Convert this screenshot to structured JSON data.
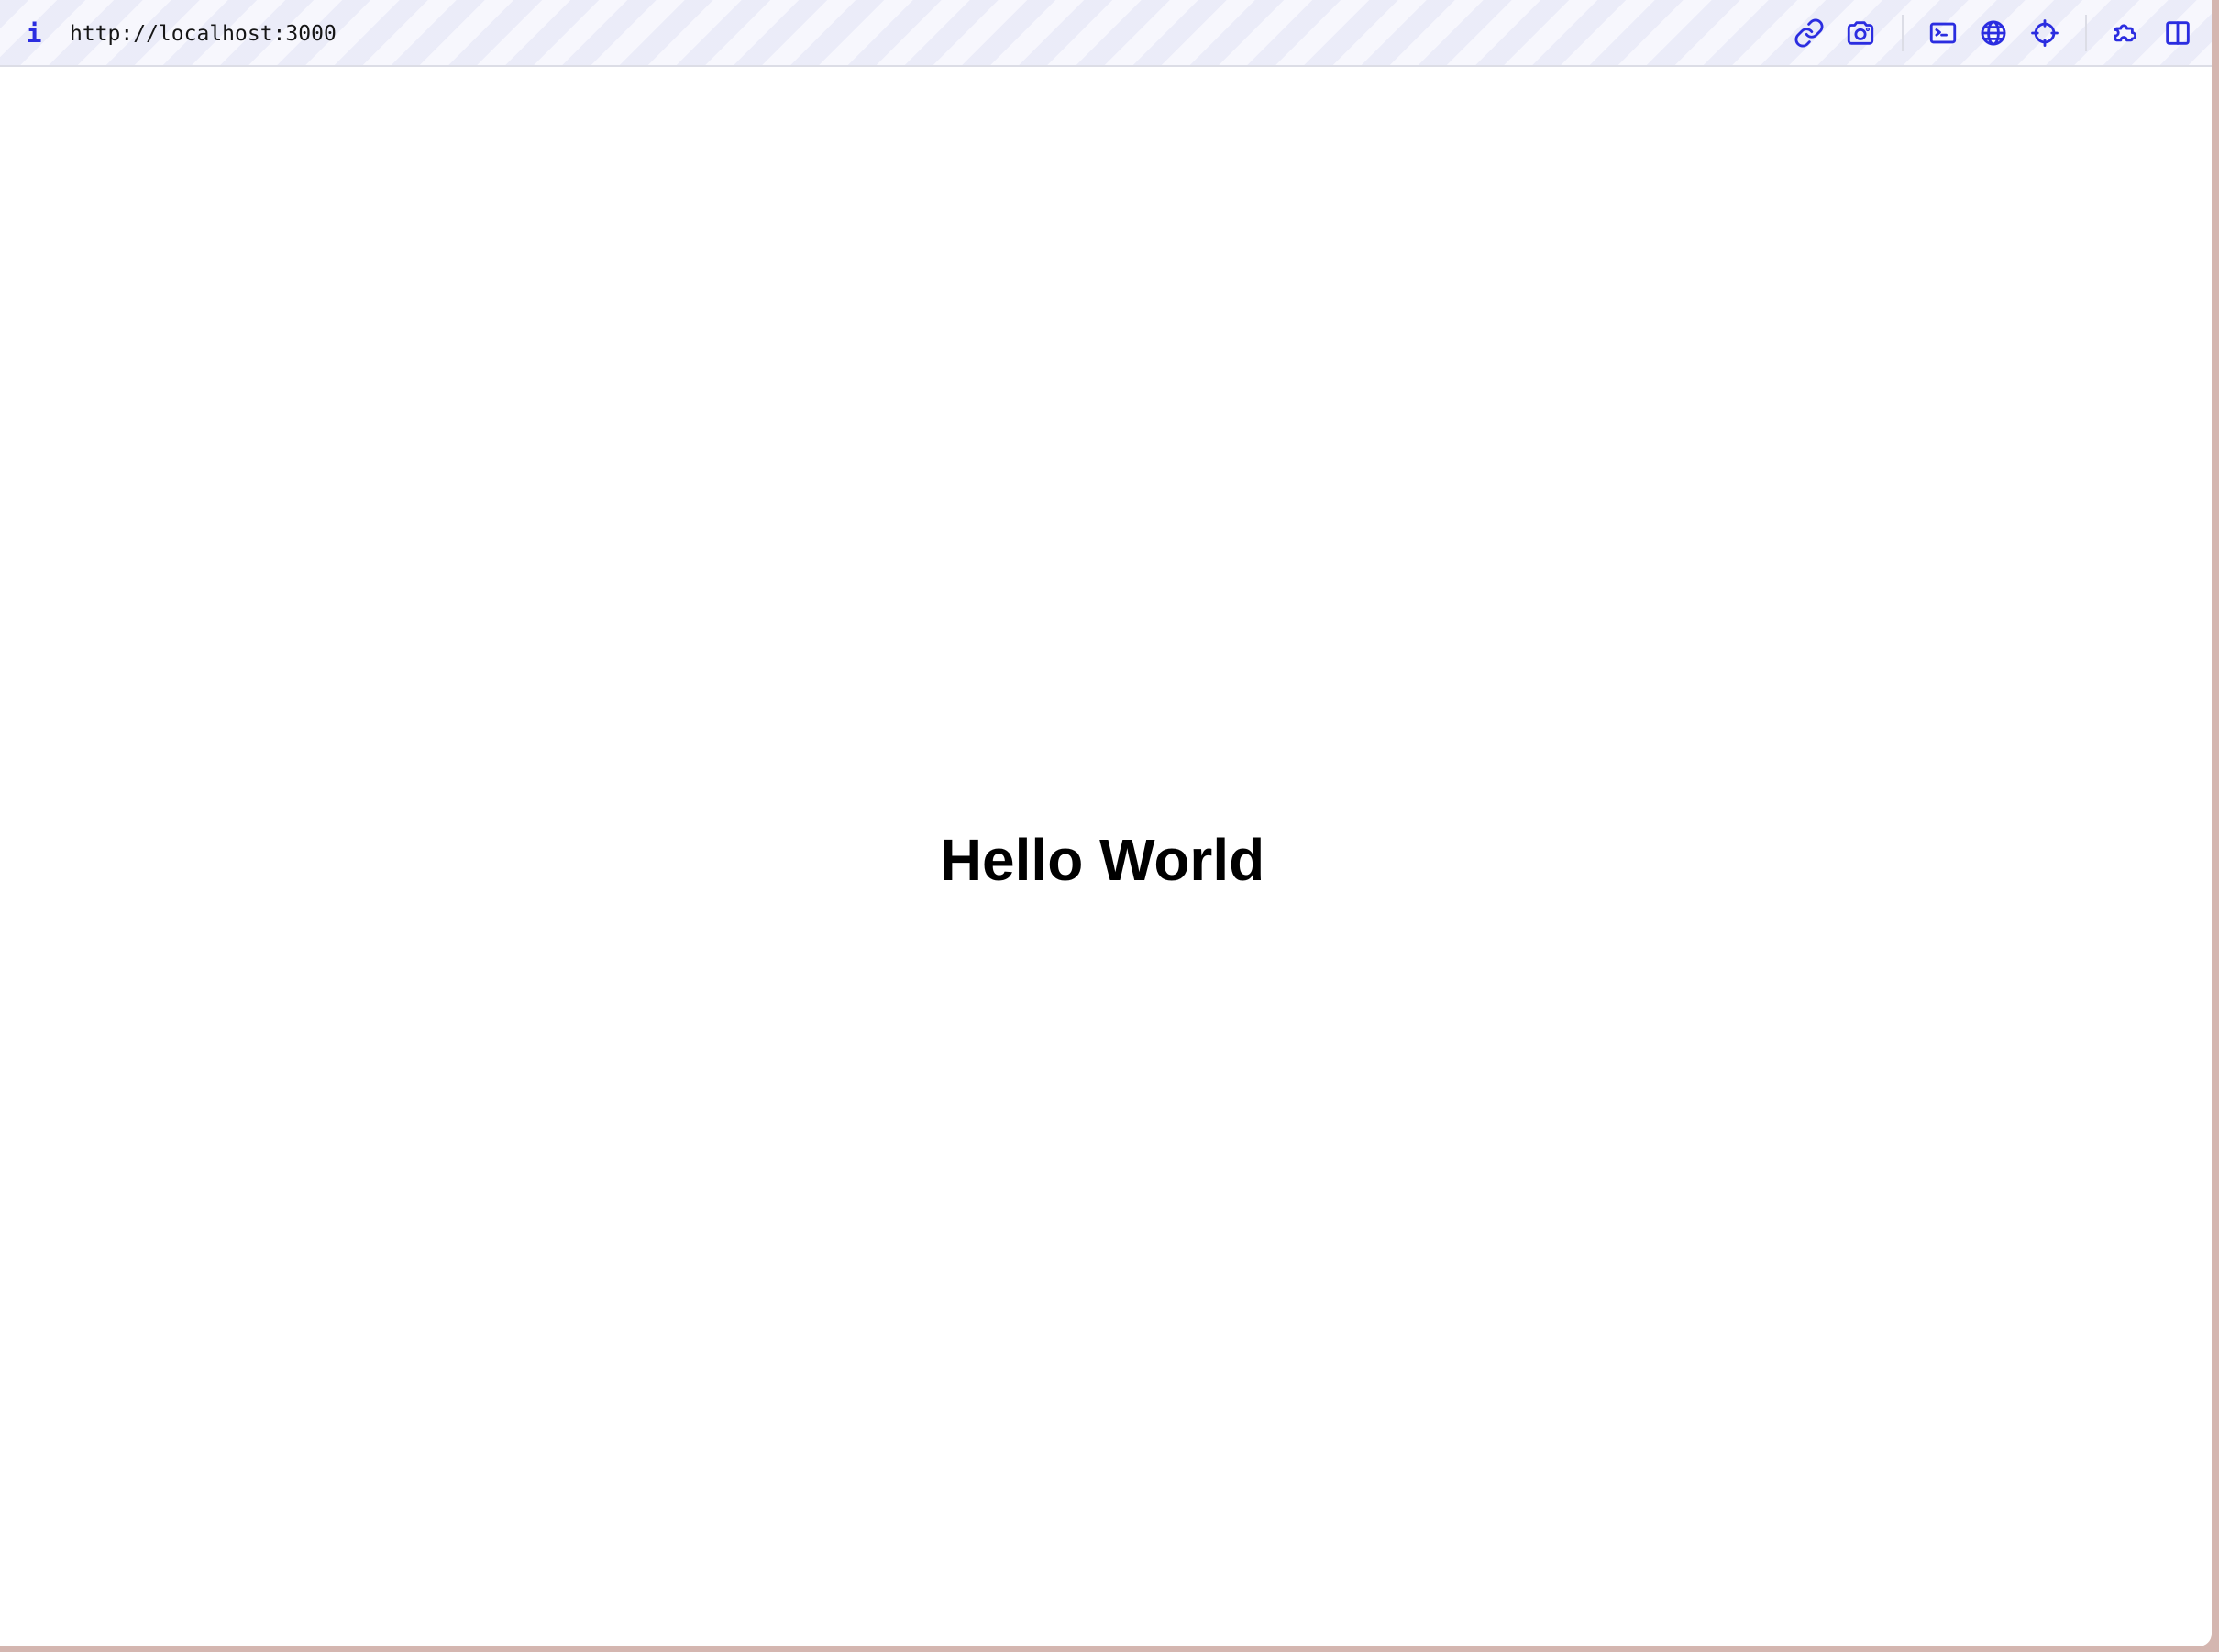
{
  "toolbar": {
    "info_label": "i",
    "url": "http://localhost:3000",
    "icons": [
      "link-icon",
      "camera-icon",
      "terminal-icon",
      "globe-icon",
      "crosshair-icon",
      "puzzle-icon",
      "sidebar-icon"
    ]
  },
  "main": {
    "heading": "Hello World"
  },
  "colors": {
    "accent": "#2b2de0",
    "toolbar_bg": "#f7f7fd",
    "page_bg": "#ffffff",
    "desktop": "#d4b6b0"
  }
}
